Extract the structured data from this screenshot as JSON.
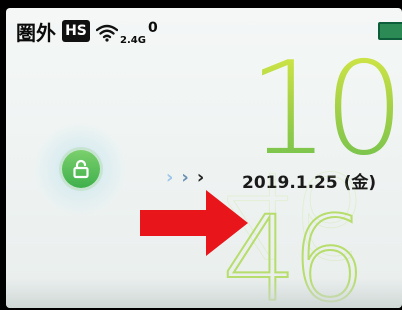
{
  "status_bar": {
    "carrier": "圏外",
    "network_badge": "HS",
    "wifi_band": "2.4G",
    "wifi_clients": "0",
    "battery_icon": "battery-icon"
  },
  "clock": {
    "hours": "10",
    "minutes": "46",
    "date": "2019.1.25 (金)"
  },
  "unlock": {
    "icon": "unlock-icon",
    "hint_chevrons": [
      "›",
      "›",
      "›"
    ]
  },
  "annotation": {
    "arrow_icon": "red-arrow-icon",
    "arrow_color": "#e8161b"
  },
  "colors": {
    "accent_green": "#7bc34f",
    "digit_yellow_green": "#c8e04d"
  }
}
